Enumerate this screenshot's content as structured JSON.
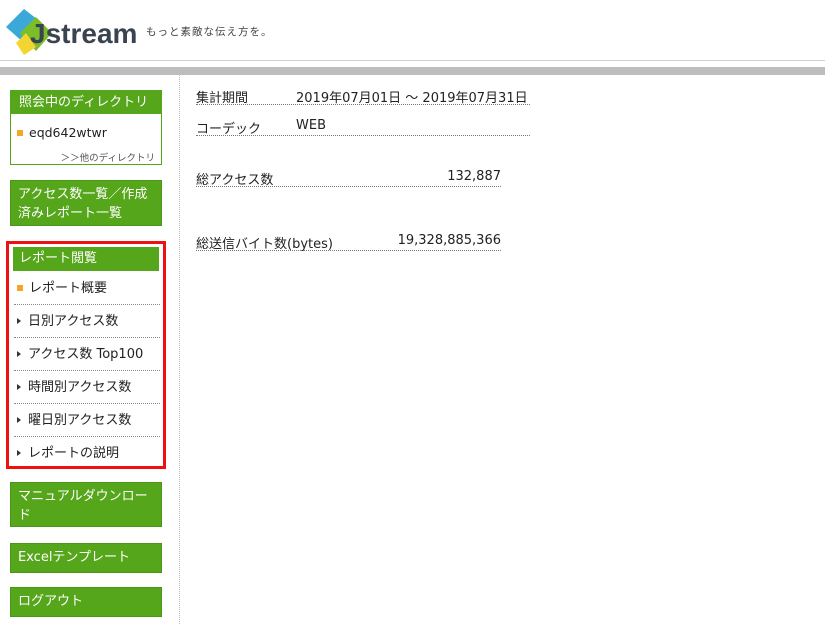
{
  "header": {
    "logo_text": "Jstream",
    "tagline": "もっと素敵な伝え方を。",
    "colors": {
      "logo_blue": "#3aa8d8",
      "logo_green": "#7cbd2a",
      "logo_yellow": "#f3d531",
      "logo_text": "#3a4450"
    }
  },
  "sidebar": {
    "directory": {
      "heading": "照会中のディレクトリ",
      "current": "eqd642wtwr",
      "other_link": "＞＞他のディレクトリ"
    },
    "access_list_button": "アクセス数一覧／作成済みレポート一覧",
    "report_menu": {
      "heading": "レポート閲覧",
      "items": [
        {
          "label": "レポート概要",
          "marker": "orange-square",
          "active": true
        },
        {
          "label": "日別アクセス数",
          "marker": "triangle"
        },
        {
          "label": "アクセス数 Top100",
          "marker": "triangle"
        },
        {
          "label": "時間別アクセス数",
          "marker": "triangle"
        },
        {
          "label": "曜日別アクセス数",
          "marker": "triangle"
        },
        {
          "label": "レポートの説明",
          "marker": "triangle"
        }
      ]
    },
    "manual_button": "マニュアルダウンロード",
    "excel_button": "Excelテンプレート",
    "logout_button": "ログアウト",
    "colors": {
      "green": "#56a61b",
      "highlight_border": "#ee1111",
      "marker_orange": "#f5a623"
    }
  },
  "main": {
    "period": {
      "label": "集計期間",
      "value": "2019年07月01日 ～ 2019年07月31日"
    },
    "codec": {
      "label": "コーデック",
      "value": "WEB"
    },
    "total_access": {
      "label": "総アクセス数",
      "value": "132,887"
    },
    "total_bytes": {
      "label": "総送信バイト数(bytes)",
      "value": "19,328,885,366"
    }
  }
}
